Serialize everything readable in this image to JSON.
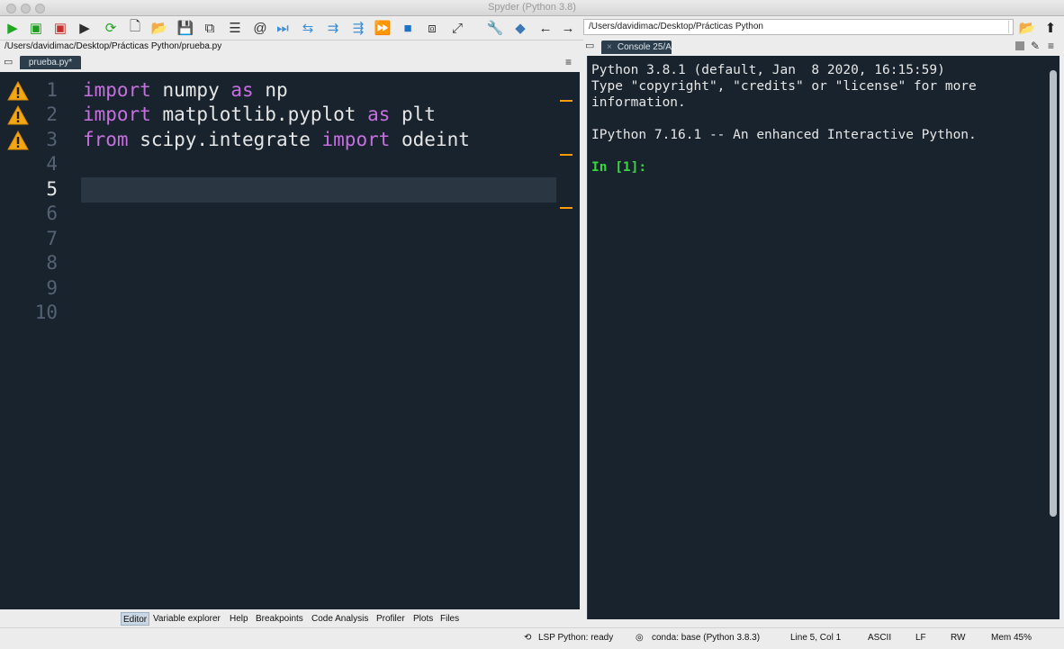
{
  "window": {
    "title": "Spyder (Python 3.8)"
  },
  "toolbar": {
    "buttons": [
      {
        "icon": "run-icon",
        "glyph": "▶",
        "color": "#1fa81f"
      },
      {
        "icon": "run-file-icon",
        "glyph": "▣",
        "color": "#1e9b1e"
      },
      {
        "icon": "run-debug-icon",
        "glyph": "▣",
        "color": "#c8312b"
      },
      {
        "icon": "run-cell-icon",
        "glyph": "▶",
        "color": "#2e2e2e"
      },
      {
        "icon": "reload-icon",
        "glyph": "⟳",
        "color": "#1fa81f"
      },
      {
        "icon": "new-file-icon",
        "glyph": "🗋",
        "color": "#333333"
      },
      {
        "icon": "open-folder-icon",
        "glyph": "📂",
        "color": "#333333"
      },
      {
        "icon": "save-icon",
        "glyph": "💾",
        "color": "#333333"
      },
      {
        "icon": "save-all-icon",
        "glyph": "⧉",
        "color": "#333333"
      },
      {
        "icon": "list-icon",
        "glyph": "☰",
        "color": "#333333"
      },
      {
        "icon": "at-icon",
        "glyph": "@",
        "color": "#333333"
      },
      {
        "icon": "step-icon",
        "glyph": "⏭",
        "color": "#3b8fd6"
      },
      {
        "icon": "step-into-icon",
        "glyph": "⇆",
        "color": "#3b8fd6"
      },
      {
        "icon": "step-return-icon",
        "glyph": "⇉",
        "color": "#3b8fd6"
      },
      {
        "icon": "step-over-icon",
        "glyph": "⇶",
        "color": "#3b8fd6"
      },
      {
        "icon": "continue-icon",
        "glyph": "⏩",
        "color": "#3b8fd6"
      },
      {
        "icon": "stop-icon",
        "glyph": "■",
        "color": "#1e73c8"
      },
      {
        "icon": "maximize-pane-icon",
        "glyph": "⧈",
        "color": "#333333"
      },
      {
        "icon": "fullscreen-icon",
        "glyph": "⤢",
        "color": "#333333"
      },
      {
        "icon": "preferences-wrench-icon",
        "glyph": "🔧",
        "color": "#333333"
      },
      {
        "icon": "python-path-icon",
        "glyph": "◆",
        "color": "#3b78b5"
      },
      {
        "icon": "back-arrow-icon",
        "glyph": "←",
        "color": "#222222"
      },
      {
        "icon": "forward-arrow-icon",
        "glyph": "→",
        "color": "#222222"
      }
    ],
    "working_dir": "/Users/davidimac/Desktop/Prácticas Python",
    "browse_icon": "📂",
    "up_icon": "⬆"
  },
  "editor": {
    "file_path": "/Users/davidimac/Desktop/Prácticas Python/prueba.py",
    "tab_label": "prueba.py*",
    "current_line": 5,
    "lines": [
      {
        "num": "1",
        "warn": true,
        "tokens": [
          {
            "t": "import",
            "kw": true
          },
          {
            "t": " numpy ",
            "kw": false
          },
          {
            "t": "as",
            "kw": true
          },
          {
            "t": " np",
            "kw": false
          }
        ]
      },
      {
        "num": "2",
        "warn": true,
        "tokens": [
          {
            "t": "import",
            "kw": true
          },
          {
            "t": " matplotlib.pyplot ",
            "kw": false
          },
          {
            "t": "as",
            "kw": true
          },
          {
            "t": " plt",
            "kw": false
          }
        ]
      },
      {
        "num": "3",
        "warn": true,
        "tokens": [
          {
            "t": "from",
            "kw": true
          },
          {
            "t": " scipy.integrate ",
            "kw": false
          },
          {
            "t": "import",
            "kw": true
          },
          {
            "t": " odeint",
            "kw": false
          }
        ]
      },
      {
        "num": "4",
        "warn": false,
        "tokens": []
      },
      {
        "num": "5",
        "warn": false,
        "tokens": []
      },
      {
        "num": "6",
        "warn": false,
        "tokens": []
      },
      {
        "num": "7",
        "warn": false,
        "tokens": []
      },
      {
        "num": "8",
        "warn": false,
        "tokens": []
      },
      {
        "num": "9",
        "warn": false,
        "tokens": []
      },
      {
        "num": "10",
        "warn": false,
        "tokens": []
      }
    ]
  },
  "bottom_tabs": [
    "Editor",
    "Variable explorer",
    "Help",
    "Breakpoints",
    "Code Analysis",
    "Profiler",
    "Plots",
    "Files"
  ],
  "console": {
    "tab_label": "Console 25/A",
    "lines": [
      "Python 3.8.1 (default, Jan  8 2020, 16:15:59)",
      "Type \"copyright\", \"credits\" or \"license\" for more",
      "information.",
      "",
      "IPython 7.16.1 -- An enhanced Interactive Python.",
      ""
    ],
    "prompt": "In [1]:"
  },
  "status": {
    "lsp": "LSP Python: ready",
    "conda": "conda: base (Python 3.8.3)",
    "position": "Line 5, Col 1",
    "encoding": "ASCII",
    "eol": "LF",
    "mode": "RW",
    "memory": "Mem 45%"
  }
}
